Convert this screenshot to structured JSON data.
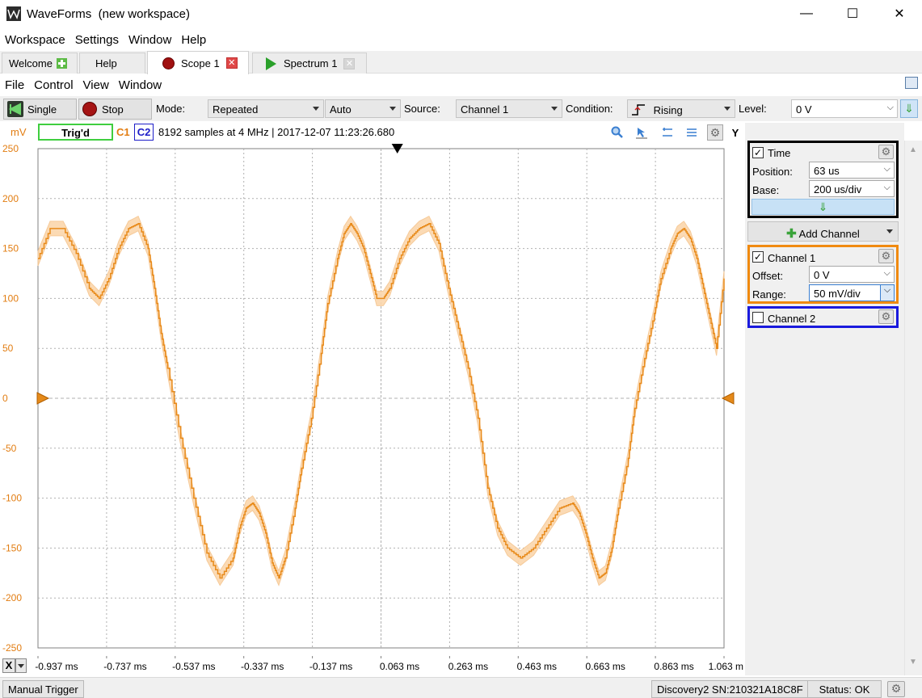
{
  "window": {
    "app_name": "WaveForms",
    "workspace": "(new workspace)",
    "minimize_glyph": "—",
    "maximize_glyph": "☐",
    "close_glyph": "✕"
  },
  "menu": [
    "Workspace",
    "Settings",
    "Window",
    "Help"
  ],
  "tabs": [
    {
      "label": "Welcome",
      "icon": "add-icon"
    },
    {
      "label": "Help"
    },
    {
      "label": "Scope 1",
      "icon": "record-icon",
      "active": true,
      "close": "red"
    },
    {
      "label": "Spectrum 1",
      "icon": "play-icon",
      "close": "grey"
    }
  ],
  "submenu": [
    "File",
    "Control",
    "View",
    "Window"
  ],
  "toolbar": {
    "single_label": "Single",
    "stop_label": "Stop",
    "mode_label": "Mode:",
    "mode_value": "Repeated",
    "auto_value": "Auto",
    "source_label": "Source:",
    "source_value": "Channel 1",
    "condition_label": "Condition:",
    "condition_value": "Rising",
    "level_label": "Level:",
    "level_value": "0 V"
  },
  "info": {
    "y_unit": "mV",
    "trig_status": "Trig'd",
    "c1": "C1",
    "c2": "C2",
    "samples": "8192 samples at 4 MHz | 2017-12-07 11:23:26.680",
    "y_button": "Y",
    "arrow": "⇒"
  },
  "panel": {
    "time": {
      "title": "Time",
      "checked": true,
      "position_label": "Position:",
      "position_value": "63 us",
      "base_label": "Base:",
      "base_value": "200 us/div"
    },
    "add_channel": "Add Channel",
    "channel1": {
      "title": "Channel 1",
      "checked": true,
      "offset_label": "Offset:",
      "offset_value": "0 V",
      "range_label": "Range:",
      "range_value": "50 mV/div"
    },
    "channel2": {
      "title": "Channel 2",
      "checked": false
    }
  },
  "status": {
    "manual_trigger": "Manual Trigger",
    "device": "Discovery2 SN:210321A18C8F",
    "status": "Status: OK"
  },
  "colors": {
    "ch1": "#e27d12",
    "ch1_band": "#fbd6ac",
    "ch2": "#1d1dc8",
    "trig_box": "#3fce3f",
    "time_box": "#000000",
    "ch1_box": "#f08a10",
    "ch2_box": "#1a1add"
  },
  "chart_data": {
    "type": "line",
    "ylabel": "mV",
    "xlabel": "",
    "ylim": [
      -250,
      250
    ],
    "xlim": [
      -1.037,
      1.063
    ],
    "y_ticks": [
      "250",
      "200",
      "150",
      "100",
      "50",
      "0",
      "-50",
      "-100",
      "-150",
      "-200",
      "-250"
    ],
    "x_ticks": [
      "-0.937 ms",
      "-0.737 ms",
      "-0.537 ms",
      "-0.337 ms",
      "-0.137 ms",
      "0.063 ms",
      "0.263 ms",
      "0.463 ms",
      "0.663 ms",
      "0.863 ms",
      "1.063 m"
    ],
    "series": [
      {
        "name": "C1",
        "x": [
          -1.037,
          -1.0,
          -0.96,
          -0.92,
          -0.88,
          -0.85,
          -0.82,
          -0.79,
          -0.76,
          -0.73,
          -0.7,
          -0.68,
          -0.66,
          -0.64,
          -0.6,
          -0.56,
          -0.52,
          -0.48,
          -0.44,
          -0.42,
          -0.4,
          -0.38,
          -0.36,
          -0.34,
          -0.32,
          -0.3,
          -0.28,
          -0.25,
          -0.23,
          -0.2,
          -0.17,
          -0.15,
          -0.12,
          -0.1,
          -0.08,
          -0.06,
          -0.04,
          -0.02,
          0.0,
          0.02,
          0.04,
          0.07,
          0.1,
          0.13,
          0.16,
          0.19,
          0.22,
          0.25,
          0.28,
          0.31,
          0.34,
          0.37,
          0.4,
          0.44,
          0.48,
          0.52,
          0.56,
          0.6,
          0.62,
          0.64,
          0.66,
          0.68,
          0.7,
          0.72,
          0.74,
          0.77,
          0.79,
          0.82,
          0.85,
          0.87,
          0.9,
          0.92,
          0.94,
          0.96,
          0.98,
          1.0,
          1.02,
          1.04,
          1.063
        ],
        "values": [
          140,
          170,
          170,
          145,
          110,
          100,
          120,
          150,
          170,
          175,
          150,
          110,
          65,
          30,
          -40,
          -100,
          -155,
          -180,
          -160,
          -130,
          -110,
          -105,
          -115,
          -135,
          -165,
          -180,
          -160,
          -110,
          -70,
          -20,
          45,
          95,
          140,
          165,
          175,
          165,
          150,
          125,
          100,
          100,
          110,
          140,
          160,
          170,
          175,
          155,
          110,
          70,
          30,
          -20,
          -90,
          -130,
          -150,
          -160,
          -150,
          -130,
          -110,
          -105,
          -115,
          -135,
          -160,
          -180,
          -175,
          -150,
          -110,
          -60,
          -10,
          40,
          85,
          120,
          150,
          165,
          170,
          160,
          140,
          110,
          80,
          50,
          120
        ]
      }
    ],
    "trigger_level": 0,
    "trigger_position": 0.063,
    "grid": true
  }
}
